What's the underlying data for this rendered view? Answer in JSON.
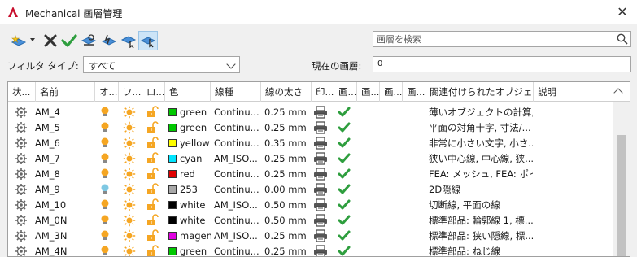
{
  "window": {
    "title": "Mechanical 画層管理",
    "close": "✕"
  },
  "toolbar": {
    "buttons": [
      "new-layer",
      "dropdown",
      "delete-layer",
      "set-current",
      "tool-a",
      "tool-b",
      "tool-c",
      "tool-d"
    ]
  },
  "search": {
    "placeholder": "画層を検索"
  },
  "filter": {
    "label": "フィルタ タイプ:",
    "value": "すべて"
  },
  "current_layer": {
    "label": "現在の画層:",
    "value": "0"
  },
  "columns": [
    "状...",
    "名前",
    "オ...",
    "フ...",
    "ロ...",
    "色",
    "線種",
    "線の太さ",
    "印...",
    "画...",
    "画...",
    "画...",
    "画...",
    "関連付けられたオブジェ...",
    "説明"
  ],
  "layers": [
    {
      "name": "AM_4",
      "on": true,
      "color_name": "green",
      "color_hex": "#00c800",
      "linetype": "Continu...",
      "lineweight": "0.25 mm",
      "assoc": "薄いオブジェクトの計算, ..."
    },
    {
      "name": "AM_5",
      "on": true,
      "color_name": "green",
      "color_hex": "#00c800",
      "linetype": "Continu...",
      "lineweight": "0.25 mm",
      "assoc": "平面の対角十字, 寸法/..."
    },
    {
      "name": "AM_6",
      "on": true,
      "color_name": "yellow",
      "color_hex": "#ffff00",
      "linetype": "Continu...",
      "lineweight": "0.35 mm",
      "assoc": "非常に小さい文字, 小さ..."
    },
    {
      "name": "AM_7",
      "on": true,
      "color_name": "cyan",
      "color_hex": "#00e5ff",
      "linetype": "AM_ISO...",
      "lineweight": "0.25 mm",
      "assoc": "狭い中心線, 中心線, 狭..."
    },
    {
      "name": "AM_8",
      "on": true,
      "color_name": "red",
      "color_hex": "#e00000",
      "linetype": "Continu...",
      "lineweight": "0.25 mm",
      "assoc": "FEA: メッシュ, FEA: ポイ..."
    },
    {
      "name": "AM_9",
      "on": false,
      "color_name": "253",
      "color_hex": "#a8a8a8",
      "linetype": "Continu...",
      "lineweight": "0.00 mm",
      "assoc": "2D隠線"
    },
    {
      "name": "AM_10",
      "on": true,
      "color_name": "white",
      "color_hex": "#000000",
      "linetype": "AM_ISO...",
      "lineweight": "0.50 mm",
      "assoc": "切断線, 平面の線"
    },
    {
      "name": "AM_0N",
      "on": true,
      "color_name": "white",
      "color_hex": "#000000",
      "linetype": "Continu...",
      "lineweight": "0.50 mm",
      "assoc": "標準部品: 輪郭線 1, 標..."
    },
    {
      "name": "AM_3N",
      "on": true,
      "color_name": "magen",
      "color_hex": "#e000e0",
      "linetype": "AM_ISO...",
      "lineweight": "0.25 mm",
      "assoc": "標準部品: 狭い隠線, 標..."
    },
    {
      "name": "AM_4N",
      "on": true,
      "color_name": "green",
      "color_hex": "#00c800",
      "linetype": "Continu...",
      "lineweight": "0.25 mm",
      "assoc": "標準部品: ねじ線"
    }
  ],
  "colors": {
    "bulb_on": "#f5a623",
    "bulb_off": "#7ec8e3",
    "sun": "#f5a623",
    "lock": "#f5a623",
    "check": "#2e9e3e",
    "selected_tool": "#cce4f7"
  }
}
